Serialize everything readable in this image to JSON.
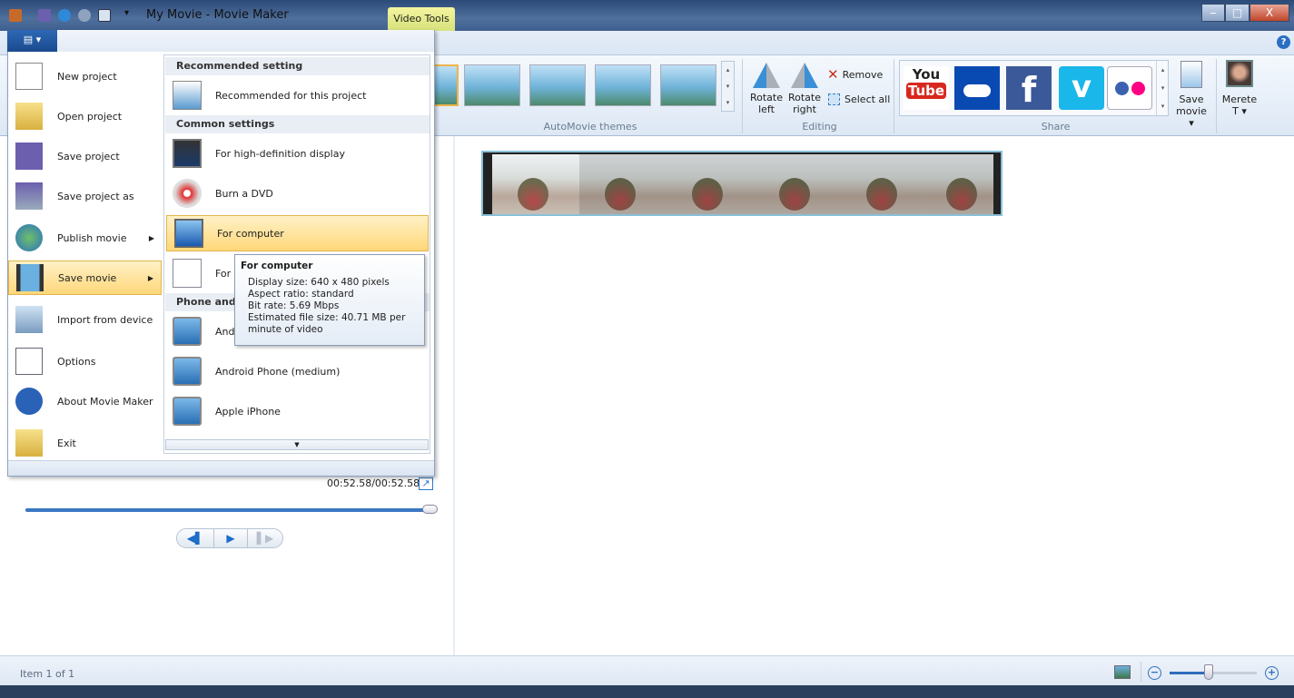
{
  "window": {
    "title": "My Movie - Movie Maker",
    "contextual_tab": "Video Tools",
    "minimize": "‒",
    "maximize": "□",
    "close": "X",
    "help": "?"
  },
  "ribbon": {
    "themes_label": "AutoMovie themes",
    "editing_label": "Editing",
    "rotate_left": [
      "Rotate",
      "left"
    ],
    "rotate_right": [
      "Rotate",
      "right"
    ],
    "remove": "Remove",
    "select_all": "Select all",
    "share_label": "Share",
    "share_services": [
      "YouTube",
      "OneDrive",
      "Facebook",
      "Vimeo",
      "Flickr"
    ],
    "save_movie": [
      "Save",
      "movie ▾"
    ],
    "account": [
      "Merete",
      "T ▾"
    ]
  },
  "app_menu": {
    "button_icon": "menu-icon",
    "items": [
      {
        "label": "New project",
        "icon": "new-document-icon"
      },
      {
        "label": "Open project",
        "icon": "open-folder-icon"
      },
      {
        "label": "Save project",
        "icon": "floppy-disk-icon"
      },
      {
        "label": "Save project as",
        "icon": "save-as-icon"
      },
      {
        "label": "Publish movie",
        "icon": "globe-icon",
        "submenu": true
      },
      {
        "label": "Save movie",
        "icon": "film-icon",
        "submenu": true,
        "selected": true
      },
      {
        "label": "Import from device",
        "icon": "camera-import-icon"
      },
      {
        "label": "Options",
        "icon": "checklist-icon"
      },
      {
        "label": "About Movie Maker",
        "icon": "info-icon"
      },
      {
        "label": "Exit",
        "icon": "exit-icon"
      }
    ]
  },
  "save_submenu": {
    "header_recommended": "Recommended setting",
    "recommended": "Recommended for this project",
    "header_common": "Common settings",
    "items": [
      {
        "label": "For high-definition display",
        "icon": "hd-display-icon"
      },
      {
        "label": "Burn a DVD",
        "icon": "dvd-icon"
      },
      {
        "label": "For computer",
        "icon": "computer-icon",
        "selected": true
      },
      {
        "label": "For email",
        "icon": "email-icon"
      }
    ],
    "header_phone": "Phone and devices",
    "phone_items": [
      "Android Phone (large)",
      "Android Phone (medium)",
      "Apple iPhone"
    ]
  },
  "tooltip": {
    "title": "For computer",
    "lines": [
      "Display size: 640 x 480 pixels",
      "Aspect ratio: standard",
      "Bit rate: 5.69 Mbps",
      "Estimated file size: 40.71 MB per",
      "minute of video"
    ]
  },
  "preview": {
    "time": "00:52.58/00:52.58",
    "progress_percent": 100
  },
  "status": {
    "item": "Item 1 of 1",
    "zoom_percent": 45
  }
}
